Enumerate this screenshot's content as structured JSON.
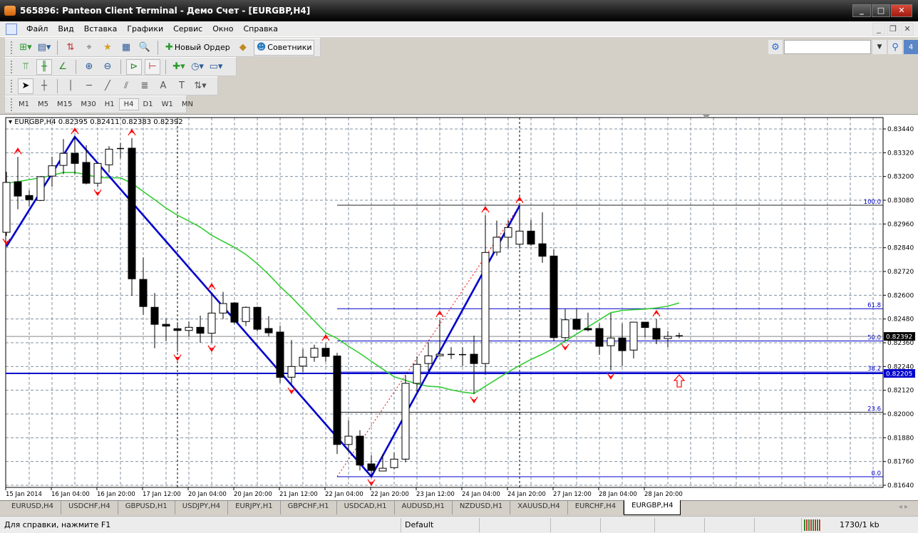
{
  "window": {
    "title": "565896: Panteon Client Terminal - Демо Счет - [EURGBP,H4]"
  },
  "menu": [
    "Файл",
    "Вид",
    "Вставка",
    "Графики",
    "Сервис",
    "Окно",
    "Справка"
  ],
  "toolbar": {
    "new_order": "Новый Ордер",
    "experts": "Советники",
    "search_value": "",
    "notifications_count": "4"
  },
  "timeframes": [
    "M1",
    "M5",
    "M15",
    "M30",
    "H1",
    "H4",
    "D1",
    "W1",
    "MN"
  ],
  "active_timeframe": "H4",
  "chart_header": {
    "symbol": "EURGBP,H4",
    "values": "0.82395 0.82411 0.82383 0.82392"
  },
  "chart_data": {
    "type": "candlestick",
    "symbol": "EURGBP",
    "timeframe": "H4",
    "ylim": [
      0.8164,
      0.8344
    ],
    "yticks": [
      "0.83440",
      "0.83320",
      "0.83200",
      "0.83080",
      "0.82960",
      "0.82840",
      "0.82720",
      "0.82600",
      "0.82480",
      "0.82360",
      "0.82240",
      "0.82120",
      "0.82000",
      "0.81880",
      "0.81760",
      "0.81640"
    ],
    "xlabels": [
      "15 Jan 2014",
      "16 Jan 04:00",
      "16 Jan 20:00",
      "17 Jan 12:00",
      "20 Jan 04:00",
      "20 Jan 20:00",
      "21 Jan 12:00",
      "22 Jan 04:00",
      "22 Jan 20:00",
      "23 Jan 12:00",
      "24 Jan 04:00",
      "24 Jan 20:00",
      "27 Jan 12:00",
      "28 Jan 04:00",
      "28 Jan 20:00"
    ],
    "xlabel_every": 4,
    "ohlc": [
      [
        0.82918,
        0.83224,
        0.829,
        0.8317
      ],
      [
        0.83173,
        0.83299,
        0.83034,
        0.83101
      ],
      [
        0.83104,
        0.8313,
        0.83048,
        0.83083
      ],
      [
        0.83079,
        0.83202,
        0.83076,
        0.83199
      ],
      [
        0.83202,
        0.833,
        0.83148,
        0.83254
      ],
      [
        0.83256,
        0.83389,
        0.83212,
        0.83317
      ],
      [
        0.83317,
        0.834,
        0.8321,
        0.83266
      ],
      [
        0.83271,
        0.83358,
        0.8316,
        0.83166
      ],
      [
        0.83166,
        0.83268,
        0.83148,
        0.83266
      ],
      [
        0.83259,
        0.83353,
        0.8322,
        0.83338
      ],
      [
        0.8334,
        0.8337,
        0.83292,
        0.83341
      ],
      [
        0.83343,
        0.83394,
        0.82597,
        0.82683
      ],
      [
        0.8268,
        0.82791,
        0.825,
        0.82543
      ],
      [
        0.82539,
        0.82611,
        0.82332,
        0.82453
      ],
      [
        0.82453,
        0.82482,
        0.82368,
        0.82444
      ],
      [
        0.82431,
        0.82464,
        0.82314,
        0.82422
      ],
      [
        0.82422,
        0.82468,
        0.82392,
        0.82438
      ],
      [
        0.82438,
        0.82497,
        0.8236,
        0.82408
      ],
      [
        0.82408,
        0.82615,
        0.8236,
        0.8251
      ],
      [
        0.8251,
        0.82617,
        0.8248,
        0.82558
      ],
      [
        0.82561,
        0.82566,
        0.82453,
        0.82464
      ],
      [
        0.82467,
        0.82543,
        0.82444,
        0.82539
      ],
      [
        0.82539,
        0.82543,
        0.82417,
        0.82428
      ],
      [
        0.82432,
        0.82494,
        0.82392,
        0.8241
      ],
      [
        0.82414,
        0.82446,
        0.82156,
        0.82185
      ],
      [
        0.82186,
        0.82374,
        0.82147,
        0.8224
      ],
      [
        0.82242,
        0.82329,
        0.82212,
        0.82287
      ],
      [
        0.82287,
        0.8235,
        0.82264,
        0.82332
      ],
      [
        0.82332,
        0.82356,
        0.82264,
        0.82291
      ],
      [
        0.82293,
        0.82309,
        0.81798,
        0.81846
      ],
      [
        0.81846,
        0.81969,
        0.8181,
        0.81888
      ],
      [
        0.81888,
        0.81918,
        0.81715,
        0.81742
      ],
      [
        0.81748,
        0.81792,
        0.81684,
        0.81715
      ],
      [
        0.81712,
        0.81798,
        0.8171,
        0.81726
      ],
      [
        0.81729,
        0.81805,
        0.8172,
        0.81772
      ],
      [
        0.81772,
        0.82194,
        0.81756,
        0.82155
      ],
      [
        0.82155,
        0.82291,
        0.82111,
        0.82251
      ],
      [
        0.82255,
        0.82363,
        0.82219,
        0.82294
      ],
      [
        0.82294,
        0.82476,
        0.82291,
        0.82302
      ],
      [
        0.823,
        0.82338,
        0.82278,
        0.82301
      ],
      [
        0.823,
        0.82338,
        0.82242,
        0.82299
      ],
      [
        0.82302,
        0.82396,
        0.82101,
        0.82255
      ],
      [
        0.82255,
        0.83004,
        0.82197,
        0.82816
      ],
      [
        0.82818,
        0.82977,
        0.828,
        0.82893
      ],
      [
        0.82893,
        0.8298,
        0.82836,
        0.82942
      ],
      [
        0.82858,
        0.83052,
        0.82836,
        0.82924
      ],
      [
        0.82924,
        0.8298,
        0.82849,
        0.82858
      ],
      [
        0.8286,
        0.83019,
        0.82764,
        0.82797
      ],
      [
        0.82798,
        0.82831,
        0.82368,
        0.82386
      ],
      [
        0.82386,
        0.8253,
        0.82368,
        0.82476
      ],
      [
        0.82479,
        0.8253,
        0.82422,
        0.82428
      ],
      [
        0.82432,
        0.82512,
        0.82417,
        0.82425
      ],
      [
        0.82432,
        0.82458,
        0.82299,
        0.82342
      ],
      [
        0.82345,
        0.82509,
        0.82221,
        0.82384
      ],
      [
        0.82384,
        0.82458,
        0.82242,
        0.8232
      ],
      [
        0.82323,
        0.82466,
        0.82281,
        0.82464
      ],
      [
        0.82464,
        0.82466,
        0.82389,
        0.82437
      ],
      [
        0.82432,
        0.82479,
        0.82353,
        0.82378
      ],
      [
        0.82381,
        0.82419,
        0.82338,
        0.82392
      ],
      [
        0.82395,
        0.82411,
        0.82383,
        0.82392
      ]
    ],
    "moving_average": [
      0.83166,
      0.83174,
      0.83184,
      0.83193,
      0.83206,
      0.8322,
      0.8322,
      0.8321,
      0.83195,
      0.83193,
      0.83193,
      0.83166,
      0.83124,
      0.83083,
      0.8304,
      0.83004,
      0.82975,
      0.82944,
      0.82903,
      0.82872,
      0.82842,
      0.82806,
      0.82759,
      0.82705,
      0.82644,
      0.8259,
      0.8253,
      0.82471,
      0.8241,
      0.82382,
      0.82342,
      0.82306,
      0.82266,
      0.82227,
      0.82188,
      0.8217,
      0.82152,
      0.8214,
      0.82137,
      0.82122,
      0.82111,
      0.82104,
      0.8214,
      0.82176,
      0.82212,
      0.82245,
      0.82276,
      0.82302,
      0.82332,
      0.82368,
      0.82404,
      0.8244,
      0.82476,
      0.82512,
      0.82523,
      0.82527,
      0.8253,
      0.82536,
      0.82545,
      0.82561
    ],
    "zigzag": [
      {
        "i": 0,
        "p": 0.82846
      },
      {
        "i": 6,
        "p": 0.834
      },
      {
        "i": 32,
        "p": 0.81684
      },
      {
        "i": 45,
        "p": 0.83052
      }
    ],
    "fractals_up": [
      1,
      6,
      11,
      18,
      28,
      38,
      42,
      45,
      57
    ],
    "fractals_down": [
      0,
      8,
      15,
      18,
      25,
      32,
      41,
      49,
      53
    ],
    "signal_arrow": {
      "i": 59,
      "direction": "up"
    },
    "period_separators": [
      15,
      45
    ],
    "fibo": {
      "from": {
        "i": 29,
        "p": 0.81684
      },
      "to": {
        "i": 45,
        "p": 0.83052
      },
      "levels": [
        {
          "label": "100.0",
          "p": 0.83055
        },
        {
          "label": "61.8",
          "p": 0.82532
        },
        {
          "label": "50.0",
          "p": 0.82369
        },
        {
          "label": "38.2",
          "p": 0.82212
        },
        {
          "label": "23.6",
          "p": 0.82009
        },
        {
          "label": "0.0",
          "p": 0.81683
        }
      ]
    },
    "hline": {
      "p": 0.82205,
      "label": "0.82205"
    },
    "bid": {
      "p": 0.82392,
      "label": "0.82392"
    },
    "colors": {
      "zigzag": "#0000cc",
      "ma": "#33cc33",
      "fractal": "#ff0000",
      "fibo": "#0000cc",
      "grid": "#8090a0"
    }
  },
  "tabs": [
    {
      "label": "EURUSD,H4"
    },
    {
      "label": "USDCHF,H4"
    },
    {
      "label": "GBPUSD,H1"
    },
    {
      "label": "USDJPY,H4"
    },
    {
      "label": "EURJPY,H1"
    },
    {
      "label": "GBPCHF,H1"
    },
    {
      "label": "USDCAD,H1"
    },
    {
      "label": "AUDUSD,H1"
    },
    {
      "label": "NZDUSD,H1"
    },
    {
      "label": "XAUUSD,H4"
    },
    {
      "label": "EURCHF,H4"
    },
    {
      "label": "EURGBP,H4",
      "active": true
    }
  ],
  "status": {
    "help": "Для справки, нажмите F1",
    "profile": "Default",
    "traffic": "1730/1 kb"
  }
}
